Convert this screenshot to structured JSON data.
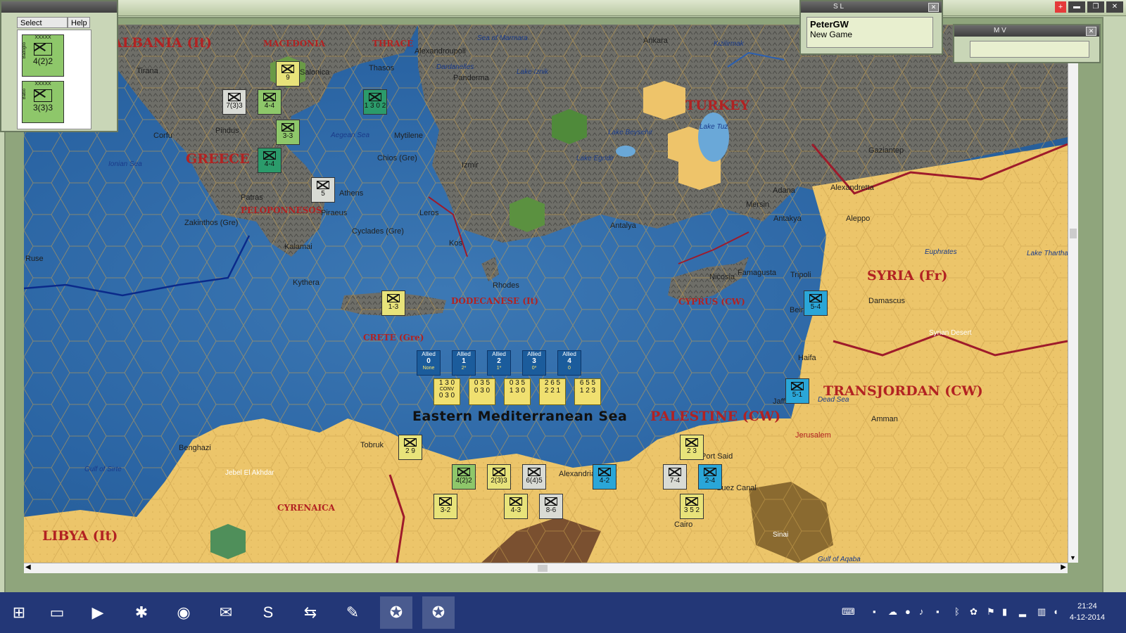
{
  "select_panel": {
    "menu_select": "Select",
    "menu_help": "Help",
    "stack": [
      {
        "commander": "Badoglio",
        "rank": "XXXXX",
        "rating": "4(2)2"
      },
      {
        "commander": "Balbo",
        "rank": "XXXXX",
        "rating": "3(3)3"
      }
    ]
  },
  "player_panel": {
    "title": "S L",
    "player": "PeterGW",
    "status": "New Game"
  },
  "mv_panel": {
    "title": "M V"
  },
  "map": {
    "regions": [
      {
        "name": "ALBANIA (It)",
        "size": "big"
      },
      {
        "name": "GREECE",
        "size": "big"
      },
      {
        "name": "TURKEY",
        "size": "big"
      },
      {
        "name": "SYRIA (Fr)",
        "size": "big"
      },
      {
        "name": "TRANSJORDAN (CW)",
        "size": "big"
      },
      {
        "name": "PALESTINE (CW)",
        "size": "big"
      },
      {
        "name": "LIBYA (It)",
        "size": "big"
      },
      {
        "name": "MACEDONIA",
        "size": "med"
      },
      {
        "name": "THRACE",
        "size": "med"
      },
      {
        "name": "PELOPONNESOS",
        "size": "med"
      },
      {
        "name": "DODECANESE (It)",
        "size": "med"
      },
      {
        "name": "CYPRUS (CW)",
        "size": "med"
      },
      {
        "name": "CRETE (Gre)",
        "size": "med"
      },
      {
        "name": "CYRENAICA",
        "size": "med"
      }
    ],
    "sea_name": "Eastern Mediterranean Sea",
    "water": [
      "Sea of Marmara",
      "Aegean Sea",
      "Ionian Sea",
      "Gulf of Sirte",
      "Lake Iznik",
      "Lake Beysehir",
      "Lake Tuz",
      "Lake Egridir",
      "Kizilirmak",
      "Euphrates",
      "Lake Thartha",
      "Dead Sea",
      "Gulf of Aqaba",
      "Dardanelles"
    ],
    "cities": [
      "Tirana",
      "Salonica",
      "Alexandroupoli",
      "Thasos",
      "Ankara",
      "Panderma",
      "Corfu",
      "Pindus",
      "Mytilene",
      "Chios (Gre)",
      "Izmir",
      "Athens",
      "Patras",
      "Piraeus",
      "Zakinthos (Gre)",
      "Cyclades (Gre)",
      "Kalamai",
      "Kythera",
      "Leros",
      "Kos",
      "Rhodes",
      "Antalya",
      "Adana",
      "Mersin",
      "Alexandretta",
      "Gaziantep",
      "Antakya",
      "Aleppo",
      "Nicosia",
      "Famagusta",
      "Tripoli",
      "Beirut",
      "Damascus",
      "Haifa",
      "Jaffa",
      "Amman",
      "Jerusalem",
      "Benghazi",
      "Tobruk",
      "Alexandria",
      "Port Said",
      "Suez Canal",
      "Cairo",
      "Jebel El Akhdar",
      "Syrian Desert",
      "Sinai",
      "Ruse"
    ],
    "turn_boxes": [
      {
        "side": "Allied",
        "num": "0",
        "sub": "None"
      },
      {
        "side": "Allied",
        "num": "1",
        "sub": "2*"
      },
      {
        "side": "Allied",
        "num": "2",
        "sub": "1*"
      },
      {
        "side": "Allied",
        "num": "3",
        "sub": "0*"
      },
      {
        "side": "Allied",
        "num": "4",
        "sub": "0"
      }
    ],
    "resource_boxes": [
      {
        "top": "1 3 0",
        "mid": "CONV",
        "bot": "0 3 0"
      },
      {
        "top": "0 3 5",
        "mid": "",
        "bot": "0 3 0"
      },
      {
        "top": "0 3 5",
        "mid": "",
        "bot": "1 3 0"
      },
      {
        "top": "2 6 5",
        "mid": "",
        "bot": "2 2 1"
      },
      {
        "top": "6 5 5",
        "mid": "",
        "bot": "1 2 3"
      }
    ],
    "units": [
      {
        "id": "greek-9",
        "label": "9"
      },
      {
        "id": "greek-733",
        "label": "7(3)3"
      },
      {
        "id": "greek-44a",
        "label": "4-4"
      },
      {
        "id": "greek-33",
        "label": "3-3"
      },
      {
        "id": "greek-44b",
        "label": "4-4"
      },
      {
        "id": "greek-5",
        "label": "5"
      },
      {
        "id": "it-dodec",
        "label": "1 3 0 2"
      },
      {
        "id": "crete",
        "label": "1-3"
      },
      {
        "id": "fr-54",
        "label": "5-4"
      },
      {
        "id": "cw-51",
        "label": "5-1"
      },
      {
        "id": "cw-29",
        "label": "2 9"
      },
      {
        "id": "it-422",
        "label": "4(2)2"
      },
      {
        "id": "it-333",
        "label": "2(3)3"
      },
      {
        "id": "it-645",
        "label": "6(4)5"
      },
      {
        "id": "cw-42",
        "label": "4-2"
      },
      {
        "id": "cw-74",
        "label": "7-4"
      },
      {
        "id": "fr-24",
        "label": "2-4"
      },
      {
        "id": "cw-air",
        "label": "2 3"
      },
      {
        "id": "it-32",
        "label": "3-2"
      },
      {
        "id": "it-43",
        "label": "4-3"
      },
      {
        "id": "cw-86",
        "label": "8-6"
      },
      {
        "id": "cw-air2",
        "label": "3 5 2"
      }
    ]
  },
  "taskbar": {
    "clock_time": "21:24",
    "clock_date": "4-12-2014",
    "apps": [
      "start-icon",
      "explorer-icon",
      "media-player-icon",
      "paint-icon",
      "chrome-icon",
      "thunderbird-icon",
      "skype-icon",
      "teamviewer-icon",
      "notepad-icon",
      "wif-icon",
      "wif-icon"
    ]
  }
}
